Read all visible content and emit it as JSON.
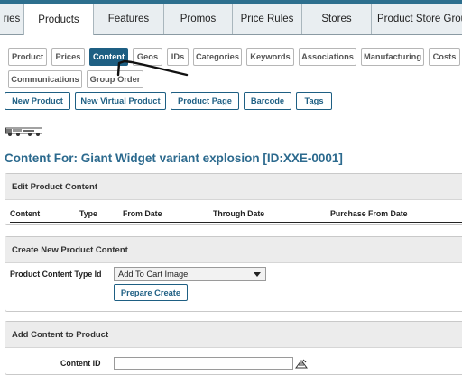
{
  "tabs": [
    {
      "label": "ries"
    },
    {
      "label": "Products"
    },
    {
      "label": "Features"
    },
    {
      "label": "Promos"
    },
    {
      "label": "Price Rules"
    },
    {
      "label": "Stores"
    },
    {
      "label": "Product Store Grou"
    }
  ],
  "subnav": [
    {
      "label": "Product"
    },
    {
      "label": "Prices"
    },
    {
      "label": "Content"
    },
    {
      "label": "Geos"
    },
    {
      "label": "IDs"
    },
    {
      "label": "Categories"
    },
    {
      "label": "Keywords"
    },
    {
      "label": "Associations"
    },
    {
      "label": "Manufacturing"
    },
    {
      "label": "Costs"
    },
    {
      "label": "Communications"
    },
    {
      "label": "Group Order"
    }
  ],
  "actions": [
    {
      "label": "New Product"
    },
    {
      "label": "New Virtual Product"
    },
    {
      "label": "Product Page"
    },
    {
      "label": "Barcode"
    },
    {
      "label": "Tags"
    }
  ],
  "page_title": "Content For: Giant Widget variant explosion [ID:XXE-0001]",
  "edit_panel": {
    "title": "Edit Product Content",
    "columns": [
      "Content",
      "Type",
      "From Date",
      "Through Date",
      "Purchase From Date"
    ]
  },
  "create_panel": {
    "title": "Create New Product Content",
    "type_label": "Product Content Type Id",
    "type_value": "Add To Cart Image",
    "prepare_button": "Prepare Create"
  },
  "add_panel": {
    "title": "Add Content to Product",
    "content_id_label": "Content ID"
  }
}
